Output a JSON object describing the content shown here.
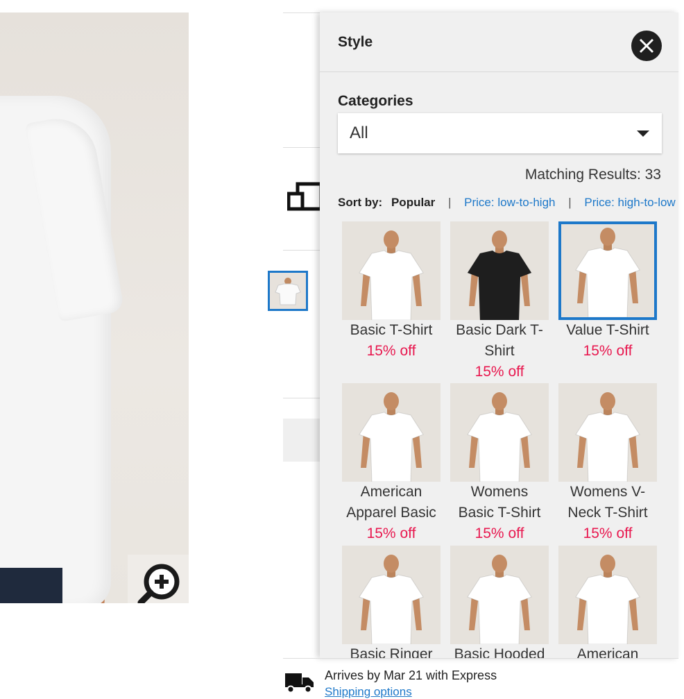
{
  "panel": {
    "title": "Style",
    "close_icon": "close-icon",
    "categories_label": "Categories",
    "category_selected": "All",
    "matching_results": "Matching Results: 33",
    "sort_label": "Sort by:",
    "sort_active": "Popular",
    "sort_separator": "|",
    "sort_options": [
      "Price: low-to-high",
      "Price: high-to-low"
    ]
  },
  "styles": [
    {
      "name": "Basic T-Shirt",
      "discount": "15% off",
      "shirt_color": "#ffffff",
      "selected": false
    },
    {
      "name": "Basic Dark T-Shirt",
      "discount": "15% off",
      "shirt_color": "#1e1e1e",
      "selected": false
    },
    {
      "name": "Value T-Shirt",
      "discount": "15% off",
      "shirt_color": "#ffffff",
      "selected": true
    },
    {
      "name": "American Apparel Basic",
      "discount": "15% off",
      "shirt_color": "#ffffff",
      "selected": false
    },
    {
      "name": "Womens Basic T-Shirt",
      "discount": "15% off",
      "shirt_color": "#ffffff",
      "selected": false
    },
    {
      "name": "Womens V-Neck T-Shirt",
      "discount": "15% off",
      "shirt_color": "#ffffff",
      "selected": false
    },
    {
      "name": "Basic Ringer",
      "discount": "",
      "shirt_color": "#ffffff",
      "selected": false
    },
    {
      "name": "Basic Hooded",
      "discount": "",
      "shirt_color": "#ffffff",
      "selected": false
    },
    {
      "name": "American",
      "discount": "",
      "shirt_color": "#ffffff",
      "selected": false
    }
  ],
  "shipping": {
    "arrives": "Arrives by Mar 21 with Express",
    "options_link": "Shipping options",
    "truck_icon": "truck-icon"
  },
  "colors": {
    "accent": "#1d78c9",
    "discount": "#e8184f"
  }
}
